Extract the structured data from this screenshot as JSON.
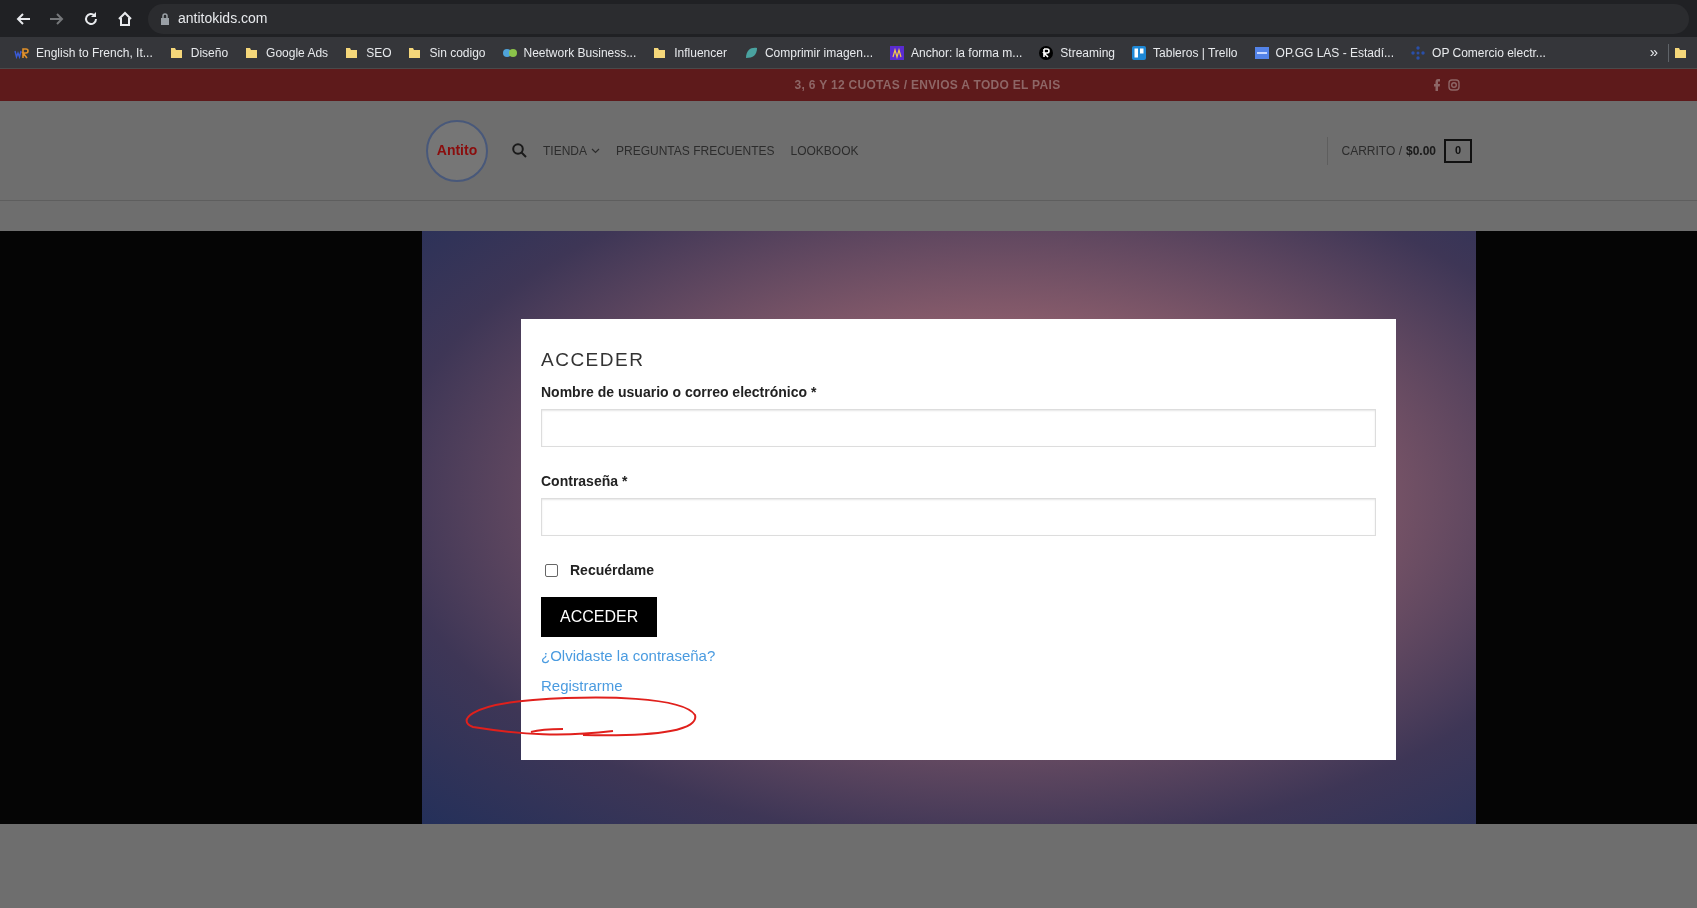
{
  "browser": {
    "nav_buttons": [
      {
        "kind": "back",
        "disabled": false
      },
      {
        "kind": "forward",
        "disabled": true
      },
      {
        "kind": "reload",
        "disabled": false
      },
      {
        "kind": "home",
        "disabled": false
      }
    ],
    "url": "antitokids.com",
    "bookmarks": [
      {
        "label": "English to French, It...",
        "kind": "letters"
      },
      {
        "label": "Diseño",
        "kind": "folder"
      },
      {
        "label": "Google Ads",
        "kind": "folder"
      },
      {
        "label": "SEO",
        "kind": "folder"
      },
      {
        "label": "Sin codigo",
        "kind": "folder"
      },
      {
        "label": "Neetwork Business...",
        "kind": "bubbles"
      },
      {
        "label": "Influencer",
        "kind": "folder"
      },
      {
        "label": "Comprimir imagen...",
        "kind": "leaf"
      },
      {
        "label": "Anchor: la forma m...",
        "kind": "anchor"
      },
      {
        "label": "Streaming",
        "kind": "rcircle"
      },
      {
        "label": "Tableros | Trello",
        "kind": "board"
      },
      {
        "label": "OP.GG LAS - Estadí...",
        "kind": "opgg"
      },
      {
        "label": "OP Comercio electr...",
        "kind": "dots"
      }
    ],
    "overflow": "»"
  },
  "promo": {
    "text": "3, 6 Y 12 CUOTAS / ENVIOS A TODO EL PAIS"
  },
  "header": {
    "logo": "Antito",
    "nav": [
      {
        "label": "TIENDA",
        "dropdown": true
      },
      {
        "label": "PREGUNTAS FRECUENTES",
        "dropdown": false
      },
      {
        "label": "LOOKBOOK",
        "dropdown": false
      }
    ],
    "cart": {
      "label": "CARRITO /",
      "total": "$0.00",
      "count": "0"
    }
  },
  "login": {
    "title": "ACCEDER",
    "fields": [
      {
        "label": "Nombre de usuario o correo electrónico *"
      },
      {
        "label": "Contraseña *"
      }
    ],
    "remember": {
      "label": "Recuérdame",
      "checked": false
    },
    "button": "ACCEDER",
    "links": [
      "¿Olvidaste la contraseña?",
      "Registrarme"
    ]
  }
}
